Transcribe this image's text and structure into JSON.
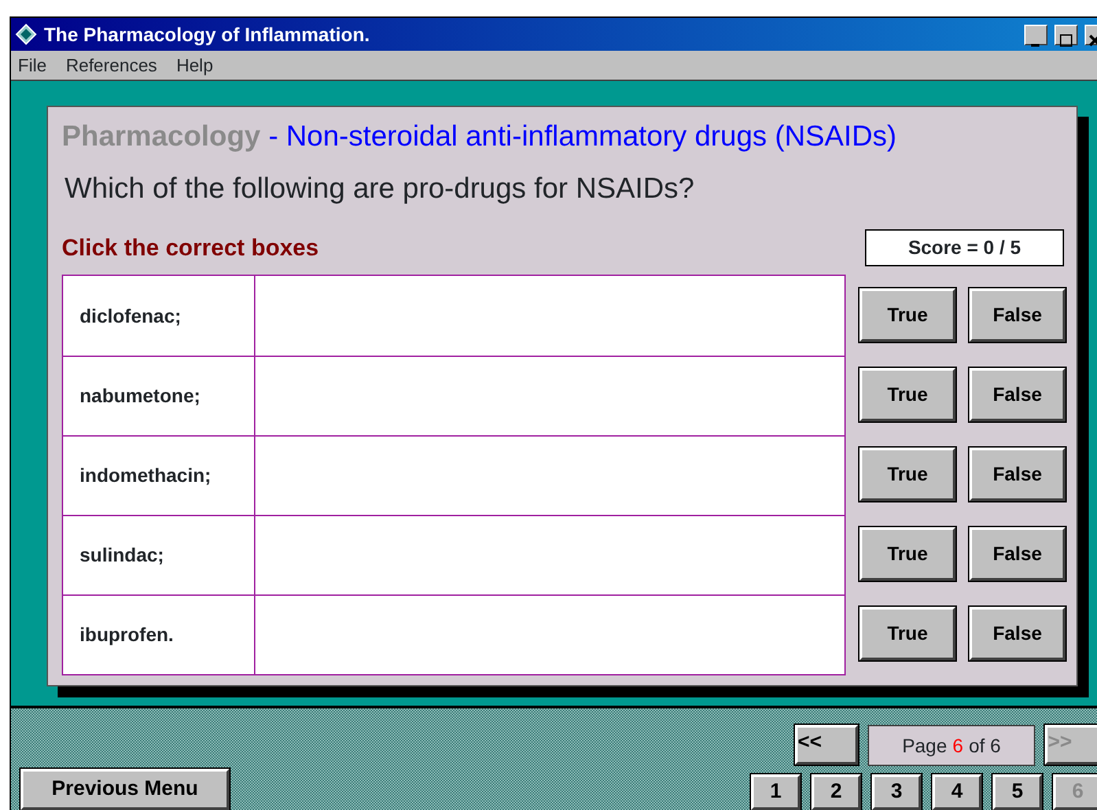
{
  "window": {
    "title": "The Pharmacology of Inflammation."
  },
  "menu": [
    {
      "label": "File"
    },
    {
      "label": "References"
    },
    {
      "label": "Help"
    }
  ],
  "header": {
    "subject": "Pharmacology",
    "topic": "- Non-steroidal anti-inflammatory drugs (NSAIDs)"
  },
  "question": "Which of the following are pro-drugs for NSAIDs?",
  "instruction": "Click the correct boxes",
  "score": "Score = 0 / 5",
  "items": [
    {
      "label": "diclofenac;",
      "buttons": [
        "True",
        "False"
      ]
    },
    {
      "label": "nabumetone;",
      "buttons": [
        "True",
        "False"
      ]
    },
    {
      "label": "indomethacin;",
      "buttons": [
        "True",
        "False"
      ]
    },
    {
      "label": "sulindac;",
      "buttons": [
        "True",
        "False"
      ]
    },
    {
      "label": "ibuprofen.",
      "buttons": [
        "True",
        "False"
      ]
    }
  ],
  "previous_menu": "Previous Menu",
  "pager": {
    "prev": "<<",
    "page_prefix": "Page",
    "page_current": "6",
    "page_suffix": "of 6",
    "next": ">>",
    "next_disabled": true,
    "pages": [
      {
        "label": "1",
        "selected": false
      },
      {
        "label": "2",
        "selected": false
      },
      {
        "label": "3",
        "selected": false
      },
      {
        "label": "4",
        "selected": false
      },
      {
        "label": "5",
        "selected": false
      },
      {
        "label": "6",
        "selected": true
      }
    ]
  }
}
